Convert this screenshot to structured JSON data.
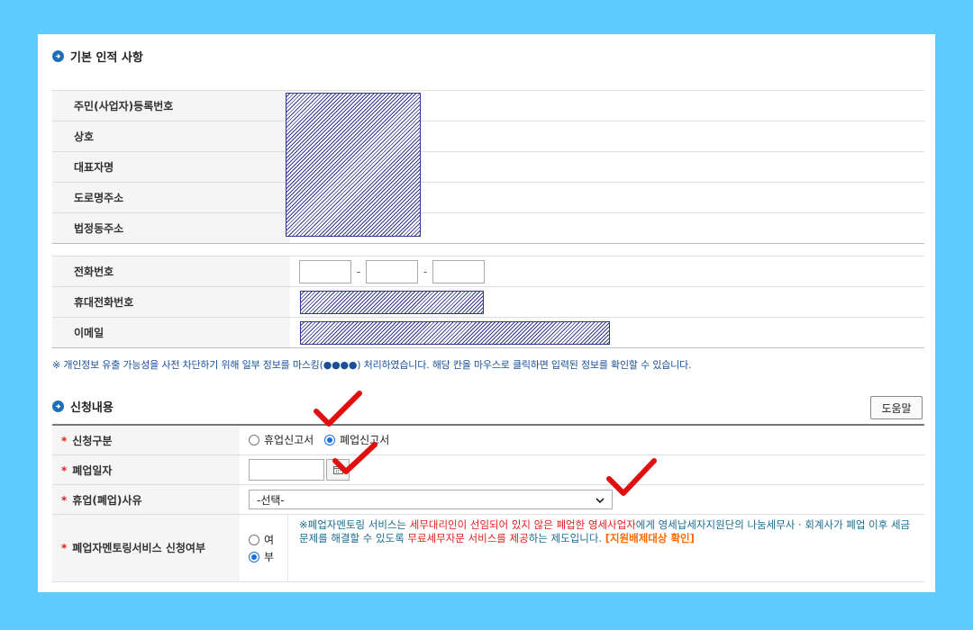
{
  "basic_section": {
    "title": "기본 인적 사항"
  },
  "info_rows": [
    {
      "label": "주민(사업자)등록번호"
    },
    {
      "label": "상호"
    },
    {
      "label": "대표자명"
    },
    {
      "label": "도로명주소"
    },
    {
      "label": "법정동주소"
    }
  ],
  "contact_rows": [
    {
      "label": "전화번호",
      "sep": "-"
    },
    {
      "label": "휴대전화번호"
    },
    {
      "label": "이메일"
    }
  ],
  "notice": "※ 개인정보 유출 가능성을 사전 차단하기 위해 일부 정보를 마스킹(●●●●) 처리하였습니다. 해당 칸을 마우스로 클릭하면 입력된 정보를 확인할 수 있습니다.",
  "apply_section": {
    "title": "신청내용",
    "help_label": "도움말"
  },
  "apply": {
    "req_mark": "*",
    "type_label": "신청구분",
    "type_options": [
      "휴업신고서",
      "폐업신고서"
    ],
    "type_selected": "폐업신고서",
    "closure_date_label": "폐업일자",
    "reason_label": "휴업(폐업)사유",
    "reason_value": "-선택-",
    "mentor_label": "폐업자멘토링서비스 신청여부",
    "mentor_options": [
      "여",
      "부"
    ],
    "mentor_selected": "부",
    "mentor_text": {
      "p1": "※폐업자멘토링 서비스는 ",
      "p2": "세무대리인이 선임되어 있지 않은 폐업한 영세사업자",
      "p3": "에게 영세납세자지원단의 나눔세무사 · 회계사가 폐업 이후 세금문제를 해결할 수 있도록 ",
      "p4": "무료세무자문 서비스를 제공",
      "p5": "하는 제도입니다. ",
      "p6": "[지원배제대상 확인]"
    }
  },
  "colors": {
    "background": "#5ccbff",
    "accent": "#1f6fb8",
    "checkmark": "#e01010",
    "mask": "#303a8c"
  }
}
